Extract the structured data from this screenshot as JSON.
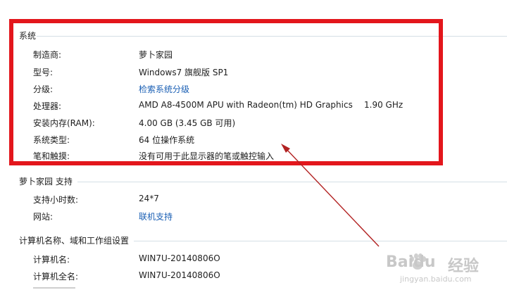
{
  "system": {
    "title": "系统",
    "rows": [
      {
        "label": "制造商:",
        "value": "萝卜家园"
      },
      {
        "label": "型号:",
        "value": "Windows7 旗舰版 SP1"
      },
      {
        "label": "分级:",
        "value": "检索系统分级"
      },
      {
        "label": "处理器:",
        "value": "AMD A8-4500M APU with Radeon(tm) HD Graphics",
        "extra": "1.90 GHz"
      },
      {
        "label": "安装内存(RAM):",
        "value": "4.00 GB (3.45 GB 可用)"
      },
      {
        "label": "系统类型:",
        "value": "64 位操作系统"
      },
      {
        "label": "笔和触摸:",
        "value": "没有可用于此显示器的笔或触控输入"
      }
    ]
  },
  "support": {
    "title": "萝卜家园 支持",
    "rows": [
      {
        "label": "支持小时数:",
        "value": "24*7"
      },
      {
        "label": "网站:",
        "value": "联机支持"
      }
    ]
  },
  "computer": {
    "title": "计算机名称、域和工作组设置",
    "rows": [
      {
        "label": "计算机名:",
        "value": "WIN7U-20140806O"
      },
      {
        "label": "计算机全名:",
        "value": "WIN7U-20140806O"
      }
    ]
  },
  "watermark": {
    "brand": "Baidu",
    "brand_cn": "经验",
    "url": "jingyan.baidu.com"
  },
  "colors": {
    "highlight_box": "#e3161c",
    "arrow": "#b22222",
    "link": "#1a5fb4"
  }
}
